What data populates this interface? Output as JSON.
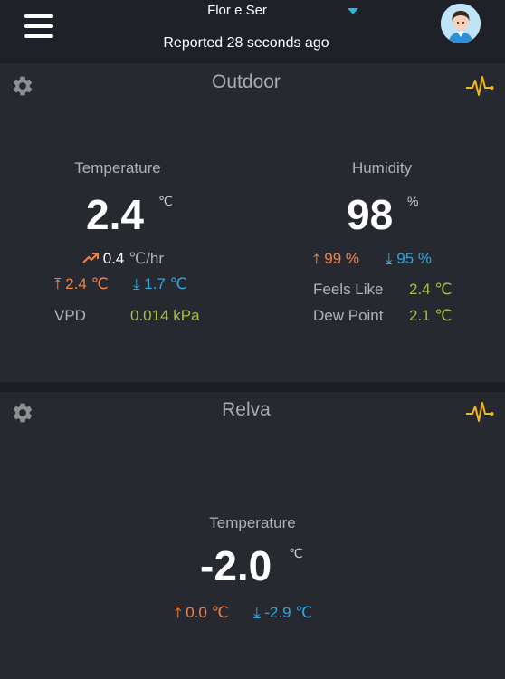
{
  "header": {
    "station_name": "Flor e Ser",
    "reported": "Reported 28 seconds ago"
  },
  "cards": [
    {
      "title": "Outdoor",
      "temperature": {
        "label": "Temperature",
        "value": "2.4",
        "unit": "℃",
        "trend": "0.4",
        "trend_unit": "℃/hr",
        "high": "2.4 ℃",
        "low": "1.7 ℃"
      },
      "vpd": {
        "label": "VPD",
        "value": "0.014 kPa"
      },
      "humidity": {
        "label": "Humidity",
        "value": "98",
        "unit": "%",
        "high": "99 %",
        "low": "95 %"
      },
      "feels_like": {
        "label": "Feels Like",
        "value": "2.4 ℃"
      },
      "dew_point": {
        "label": "Dew Point",
        "value": "2.1 ℃"
      }
    },
    {
      "title": "Relva",
      "temperature": {
        "label": "Temperature",
        "value": "-2.0",
        "unit": "℃",
        "high": "0.0 ℃",
        "low": "-2.9 ℃"
      }
    }
  ],
  "colors": {
    "accent_blue": "#2ea6e0",
    "high_orange": "#f0834a",
    "value_green": "#a6bf3c",
    "pulse_yellow": "#f2b51c"
  },
  "icons": [
    "menu-icon",
    "chevron-down-icon",
    "avatar",
    "gear-icon",
    "pulse-icon",
    "trend-up-icon",
    "arrow-up-icon",
    "arrow-down-icon"
  ]
}
